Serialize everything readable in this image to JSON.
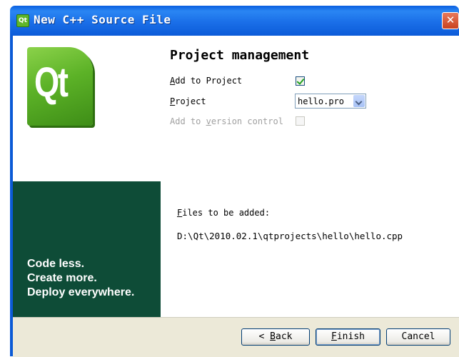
{
  "window": {
    "title": "New C++ Source File",
    "icon_text": "Qt",
    "close_glyph": "✕"
  },
  "sidebar": {
    "logo_text": "Qt",
    "slogan": [
      "Code less.",
      "Create more.",
      "Deploy everywhere."
    ],
    "colors": {
      "banner": "#0e4c37",
      "logo": "#5cb227"
    }
  },
  "page": {
    "heading": "Project management",
    "add_to_project": {
      "label_first": "A",
      "label_rest": "dd to Project",
      "checked": true
    },
    "project": {
      "label_first": "P",
      "label_rest": "roject",
      "value": "hello.pro"
    },
    "version_control": {
      "label_pre": "Add to ",
      "label_ul": "v",
      "label_post": "ersion control",
      "checked": false,
      "enabled": false
    },
    "files_label_first": "F",
    "files_label_rest": "iles to be added:",
    "file_path": "D:\\Qt\\2010.02.1\\qtprojects\\hello\\hello.cpp"
  },
  "buttons": {
    "back": {
      "arrow": "<",
      "first": "B",
      "rest": "ack"
    },
    "finish": {
      "first": "F",
      "rest": "inish"
    },
    "cancel": {
      "label": "Cancel"
    }
  }
}
